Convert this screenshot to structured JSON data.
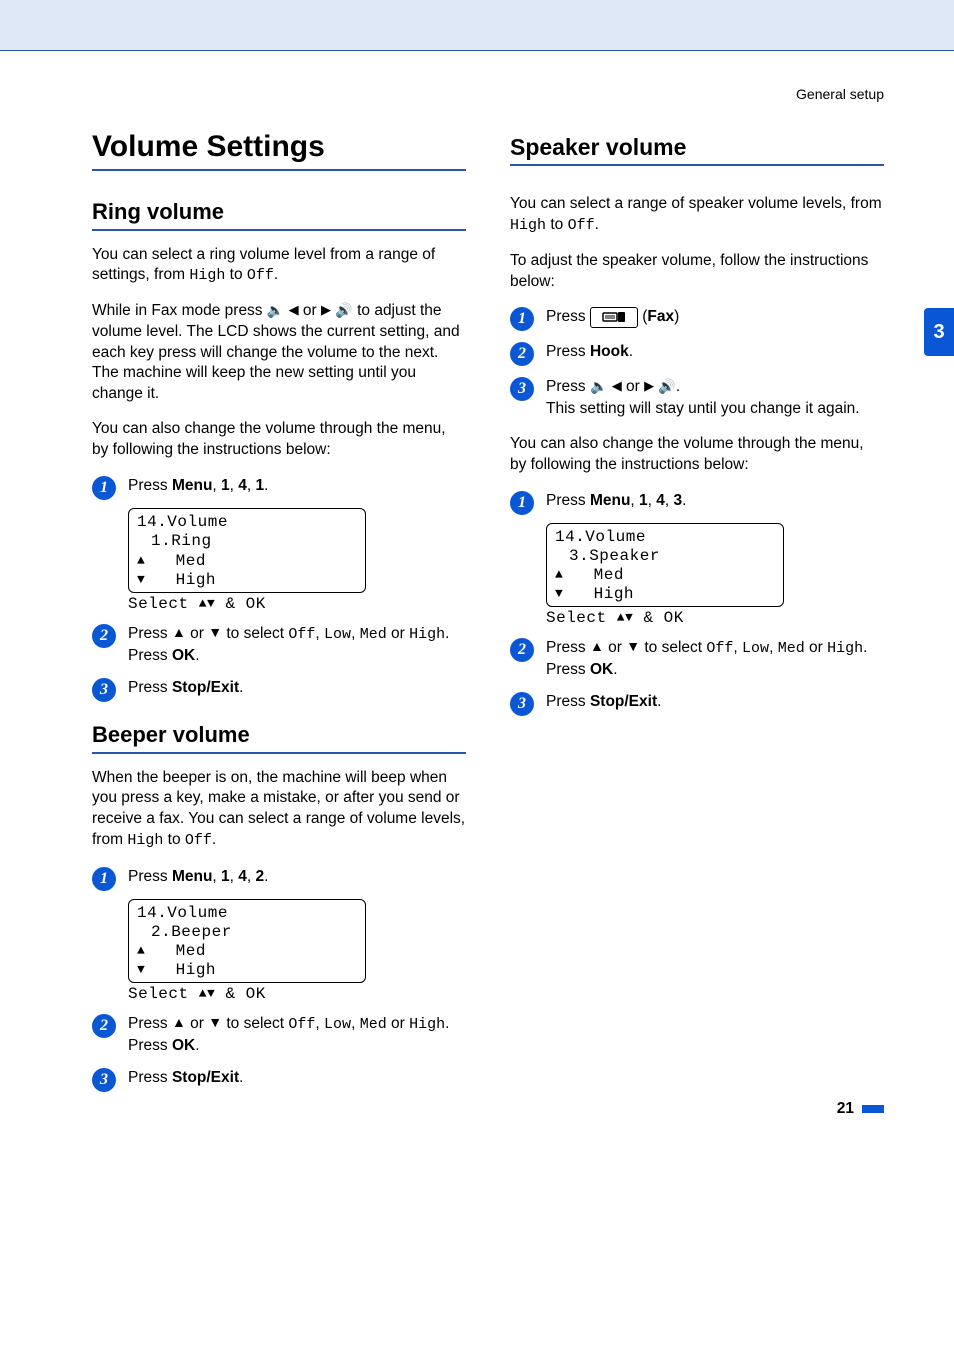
{
  "header": {
    "breadcrumb": "General setup"
  },
  "sideTab": "3",
  "pageNumber": "21",
  "left": {
    "title": "Volume Settings",
    "ring": {
      "title": "Ring volume",
      "p1_a": "You can select a ring volume level from a range of settings, from ",
      "p1_b": " to ",
      "p1_high": "High",
      "p1_off": "Off",
      "p2_a": "While in Fax mode press ",
      "p2_b": " or ",
      "p2_c": " to adjust the volume level. The LCD shows the current setting, and each key press will change the volume to the next. The machine will keep the new setting until you change it.",
      "p3": "You can also change the volume through the menu, by following the instructions below:",
      "steps": {
        "s1_a": "Press ",
        "s1_menu": "Menu",
        "s1_b": ", ",
        "s1_n1": "1",
        "s1_n2": "4",
        "s1_n3": "1",
        "lcd_l1": "14.Volume",
        "lcd_l2": "1.Ring",
        "lcd_l3": "Med",
        "lcd_l4": "High",
        "lcd_foot_a": "Select ",
        "lcd_foot_b": " & OK",
        "s2_a": "Press ",
        "s2_b": " or ",
        "s2_c": " to select ",
        "opt_off": "Off",
        "opt_low": "Low",
        "opt_med": "Med",
        "opt_high": "High",
        "s2_d": " or ",
        "s2_e": ". Press ",
        "s2_ok": "OK",
        "s2_f": ".",
        "s3_a": "Press ",
        "s3_stop": "Stop/Exit",
        "s3_b": "."
      }
    },
    "beeper": {
      "title": "Beeper volume",
      "p1_a": "When the beeper is on, the machine will beep when you press a key, make a mistake, or after you send or receive a fax. You can select a range of volume levels, from ",
      "p1_high": "High",
      "p1_b": " to ",
      "p1_off": "Off",
      "p1_c": ".",
      "steps": {
        "s1_a": "Press ",
        "s1_menu": "Menu",
        "s1_b": ", ",
        "s1_n1": "1",
        "s1_n2": "4",
        "s1_n3": "2",
        "lcd_l1": "14.Volume",
        "lcd_l2": "2.Beeper",
        "lcd_l3": "Med",
        "lcd_l4": "High",
        "lcd_foot_a": "Select ",
        "lcd_foot_b": " & OK",
        "s2_a": "Press ",
        "s2_b": " or ",
        "s2_c": " to select ",
        "opt_off": "Off",
        "opt_low": "Low",
        "opt_med": "Med",
        "opt_high": "High",
        "s2_d": " or ",
        "s2_e": ". Press ",
        "s2_ok": "OK",
        "s2_f": ".",
        "s3_a": "Press ",
        "s3_stop": "Stop/Exit",
        "s3_b": "."
      }
    }
  },
  "right": {
    "title": "Speaker volume",
    "p1_a": "You can select a range of speaker volume levels, from ",
    "p1_high": "High",
    "p1_b": " to ",
    "p1_off": "Off",
    "p1_c": ".",
    "p2": "To adjust the speaker volume, follow the instructions below:",
    "steps1": {
      "s1_a": "Press ",
      "s1_b": " (",
      "s1_fax": "Fax",
      "s1_c": ")",
      "s2_a": "Press ",
      "s2_hook": "Hook",
      "s2_b": ".",
      "s3_a": "Press ",
      "s3_b": " or ",
      "s3_c": ".",
      "s3_d": "This setting will stay until you change it again."
    },
    "p3": "You can also change the volume through the menu, by following the instructions below:",
    "steps2": {
      "s1_a": "Press ",
      "s1_menu": "Menu",
      "s1_b": ", ",
      "s1_n1": "1",
      "s1_n2": "4",
      "s1_n3": "3",
      "lcd_l1": "14.Volume",
      "lcd_l2": "3.Speaker",
      "lcd_l3": "Med",
      "lcd_l4": "High",
      "lcd_foot_a": "Select ",
      "lcd_foot_b": " & OK",
      "s2_a": "Press ",
      "s2_b": " or ",
      "s2_c": " to select ",
      "opt_off": "Off",
      "opt_low": "Low",
      "opt_med": "Med",
      "opt_high": "High",
      "s2_d": " or ",
      "s2_e": ". Press ",
      "s2_ok": "OK",
      "s2_f": ".",
      "s3_a": "Press ",
      "s3_stop": "Stop/Exit",
      "s3_b": "."
    }
  }
}
